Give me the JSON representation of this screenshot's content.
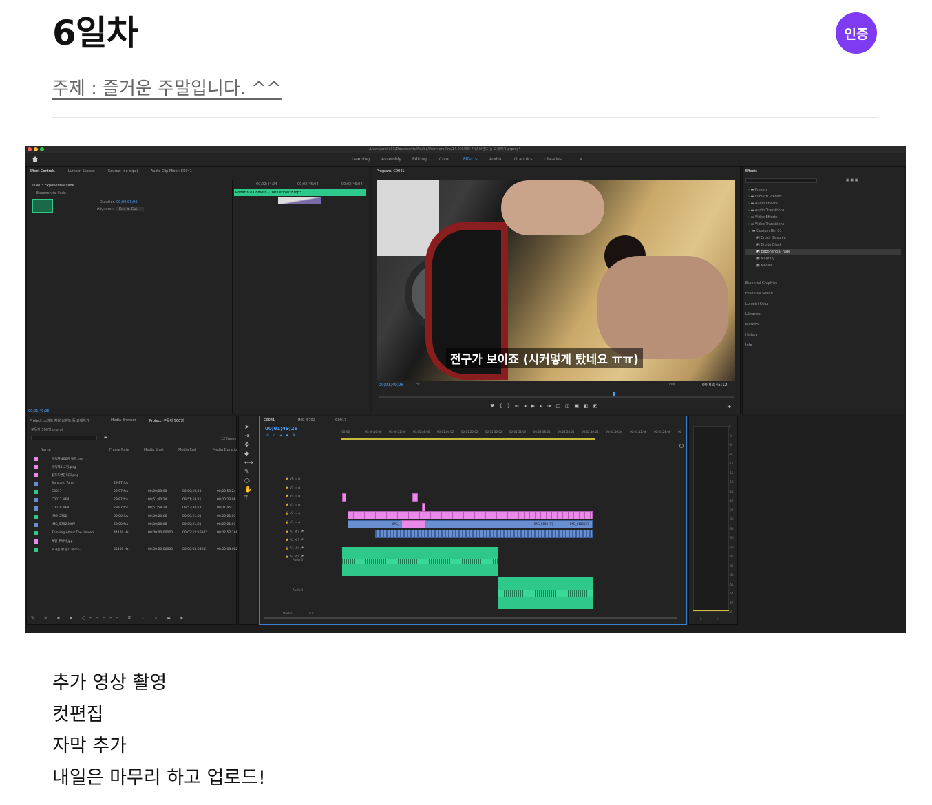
{
  "post": {
    "title": "6일차",
    "badge": "인증",
    "topic": "주제 : 즐거운 주말입니다. ^^"
  },
  "editor": {
    "window_title": "/Users/ursha93/Documents/Adobe/Premiere Pro/14.0/스마트 차량 브랜드 등 교체하기.prproj *",
    "workspaces": [
      "Learning",
      "Assembly",
      "Editing",
      "Color",
      "Effects",
      "Audio",
      "Graphics",
      "Libraries"
    ],
    "active_workspace": "Effects",
    "effect_controls": {
      "tabs": [
        "Effect Controls",
        "Lumetri Scopes",
        "Source: (no clips)",
        "Audio Clip Mixer: C0041"
      ],
      "clip": "C0041 * Exponential Fade",
      "effect": "Exponential Fade",
      "duration_label": "Duration",
      "duration": "00;00;01;00",
      "alignment_label": "Alignment",
      "alignment": "End at Cut",
      "tc1": "00;02;44;04",
      "tc2": "00;02;45;04",
      "tc3": "00;02;46;04",
      "track_clip": "Roberto e Cometh - Dar Lebowitz.mp3",
      "timecode": "00;01;49;26"
    },
    "program": {
      "tab": "Program: C0041",
      "subtitle": "전구가 보이죠 (시커멓게 탔네요 ㅠㅠ)",
      "timecode": "00;01;49;26",
      "fit": "Fit",
      "quality": "Full",
      "duration": "00;02;45;12"
    },
    "effects_panel": {
      "title": "Effects",
      "folders": [
        "Presets",
        "Lumetri Presets",
        "Audio Effects",
        "Audio Transitions",
        "Video Effects",
        "Video Transitions",
        "Custom Bin 01"
      ],
      "custom_items": [
        "Cross Dissolve",
        "Dip to Black",
        "Exponential Fade",
        "Magnify",
        "Mosaic"
      ],
      "sections": [
        "Essential Graphics",
        "Essential Sound",
        "Lumetri Color",
        "Libraries",
        "Markers",
        "History",
        "Info"
      ]
    },
    "project": {
      "tabs": [
        "Project: 스마트 차량 브랜드 등 교체하기",
        "Media Browser",
        "Project: 구독자 500명"
      ],
      "bin": "구독자 500명.prproj",
      "items_count": "12 Items",
      "columns": [
        "Name",
        "Frame Rate",
        "Media Start",
        "Media End",
        "Media Duratio"
      ],
      "rows": [
        {
          "name": "구독자 400명 돌파.png",
          "rate": "",
          "start": "",
          "end": "",
          "dur": "",
          "color": "#e98ae8"
        },
        {
          "name": "구독자512명.png",
          "rate": "",
          "start": "",
          "end": "",
          "dur": "",
          "color": "#e98ae8"
        },
        {
          "name": "컴포드엔딩디자.png",
          "rate": "",
          "start": "",
          "end": "",
          "dur": "",
          "color": "#e98ae8"
        },
        {
          "name": "Bars and Tone",
          "rate": "29.97 fps",
          "start": "",
          "end": "",
          "dur": "",
          "color": "#6a8fd0"
        },
        {
          "name": "C0017",
          "rate": "29.97 fps",
          "start": "00;00;00;00",
          "end": "00;00;59;23",
          "dur": "00;00;59;24",
          "color": "#2ec98a"
        },
        {
          "name": "C0017.MP4",
          "rate": "29.97 fps",
          "start": "09;51;40;24",
          "end": "09;51;58;21",
          "dur": "00;00;23;08",
          "color": "#6a8fd0"
        },
        {
          "name": "C0018.MP4",
          "rate": "29.97 fps",
          "start": "09;51;58;24",
          "end": "09;53;44;14",
          "dur": "00;01;45;17",
          "color": "#6a8fd0"
        },
        {
          "name": "IMG_5702",
          "rate": "60.00 fps",
          "start": "00;00;00;00",
          "end": "00;00;21;01",
          "dur": "00;00;21;01",
          "color": "#2ec98a"
        },
        {
          "name": "IMG_5702.MOV",
          "rate": "60.00 fps",
          "start": "00;00;00;00",
          "end": "00;00;21;01",
          "dur": "00;00;21;01",
          "color": "#6a8fd0"
        },
        {
          "name": "Thinking About The Univers",
          "rate": "44100 Hz",
          "start": "00:00:00:00000",
          "end": "00:02:52:16847",
          "dur": "00:02:52:168",
          "color": "#2ec98a"
        },
        {
          "name": "채팅 추박이.jpg",
          "rate": "",
          "start": "",
          "end": "",
          "dur": "",
          "color": "#e98ae8"
        },
        {
          "name": "효과음 땅 뭉다쳐.mp3",
          "rate": "44100 Hz",
          "start": "00:00:00:00000",
          "end": "00:00:03:08281",
          "dur": "00:00:03:082",
          "color": "#2ec98a"
        }
      ]
    },
    "timeline": {
      "tabs": [
        "C0041",
        "IMG_5702",
        "C0017"
      ],
      "timecode": "00;01;49;26",
      "ruler": [
        ";00;00",
        "00;00;16;00",
        "00;00;32;00",
        "00;00;48;00",
        "00;01;04;02",
        "00;01;20;02",
        "00;01;36;02",
        "00;01;52;02",
        "00;02;08;04",
        "00;02;24;04",
        "00;02;40;04",
        "00;02;56;04",
        "00;03;12;06",
        "00;03;28;06",
        "00"
      ],
      "video_tracks": [
        "V6",
        "V5",
        "V4",
        "V3",
        "V2",
        "V1"
      ],
      "audio_tracks": [
        "A1",
        "A2",
        "A3",
        "A4"
      ],
      "audio3_label": "Audio 3",
      "audio4_label": "Audio 4",
      "master_label": "Master",
      "master_value": "0.0",
      "v1_clip_a": "IMG_6180 [V]",
      "v1_clip_b": "IMG_6180 [V]",
      "v1_clip_c": "IMG_",
      "meter": [
        "0",
        "-3",
        "-6",
        "-9",
        "-12",
        "-15",
        "-18",
        "-21",
        "-24",
        "-27",
        "-30",
        "-33",
        "-36",
        "-39",
        "-42",
        "-45",
        "-48",
        "-51",
        "-54",
        "-57",
        "dB"
      ],
      "meter_bottom": [
        "S",
        "S"
      ]
    }
  },
  "body": {
    "lines": [
      "추가 영상 촬영",
      "컷편집",
      "자막 추가",
      "내일은 마무리 하고 업로드!"
    ]
  }
}
